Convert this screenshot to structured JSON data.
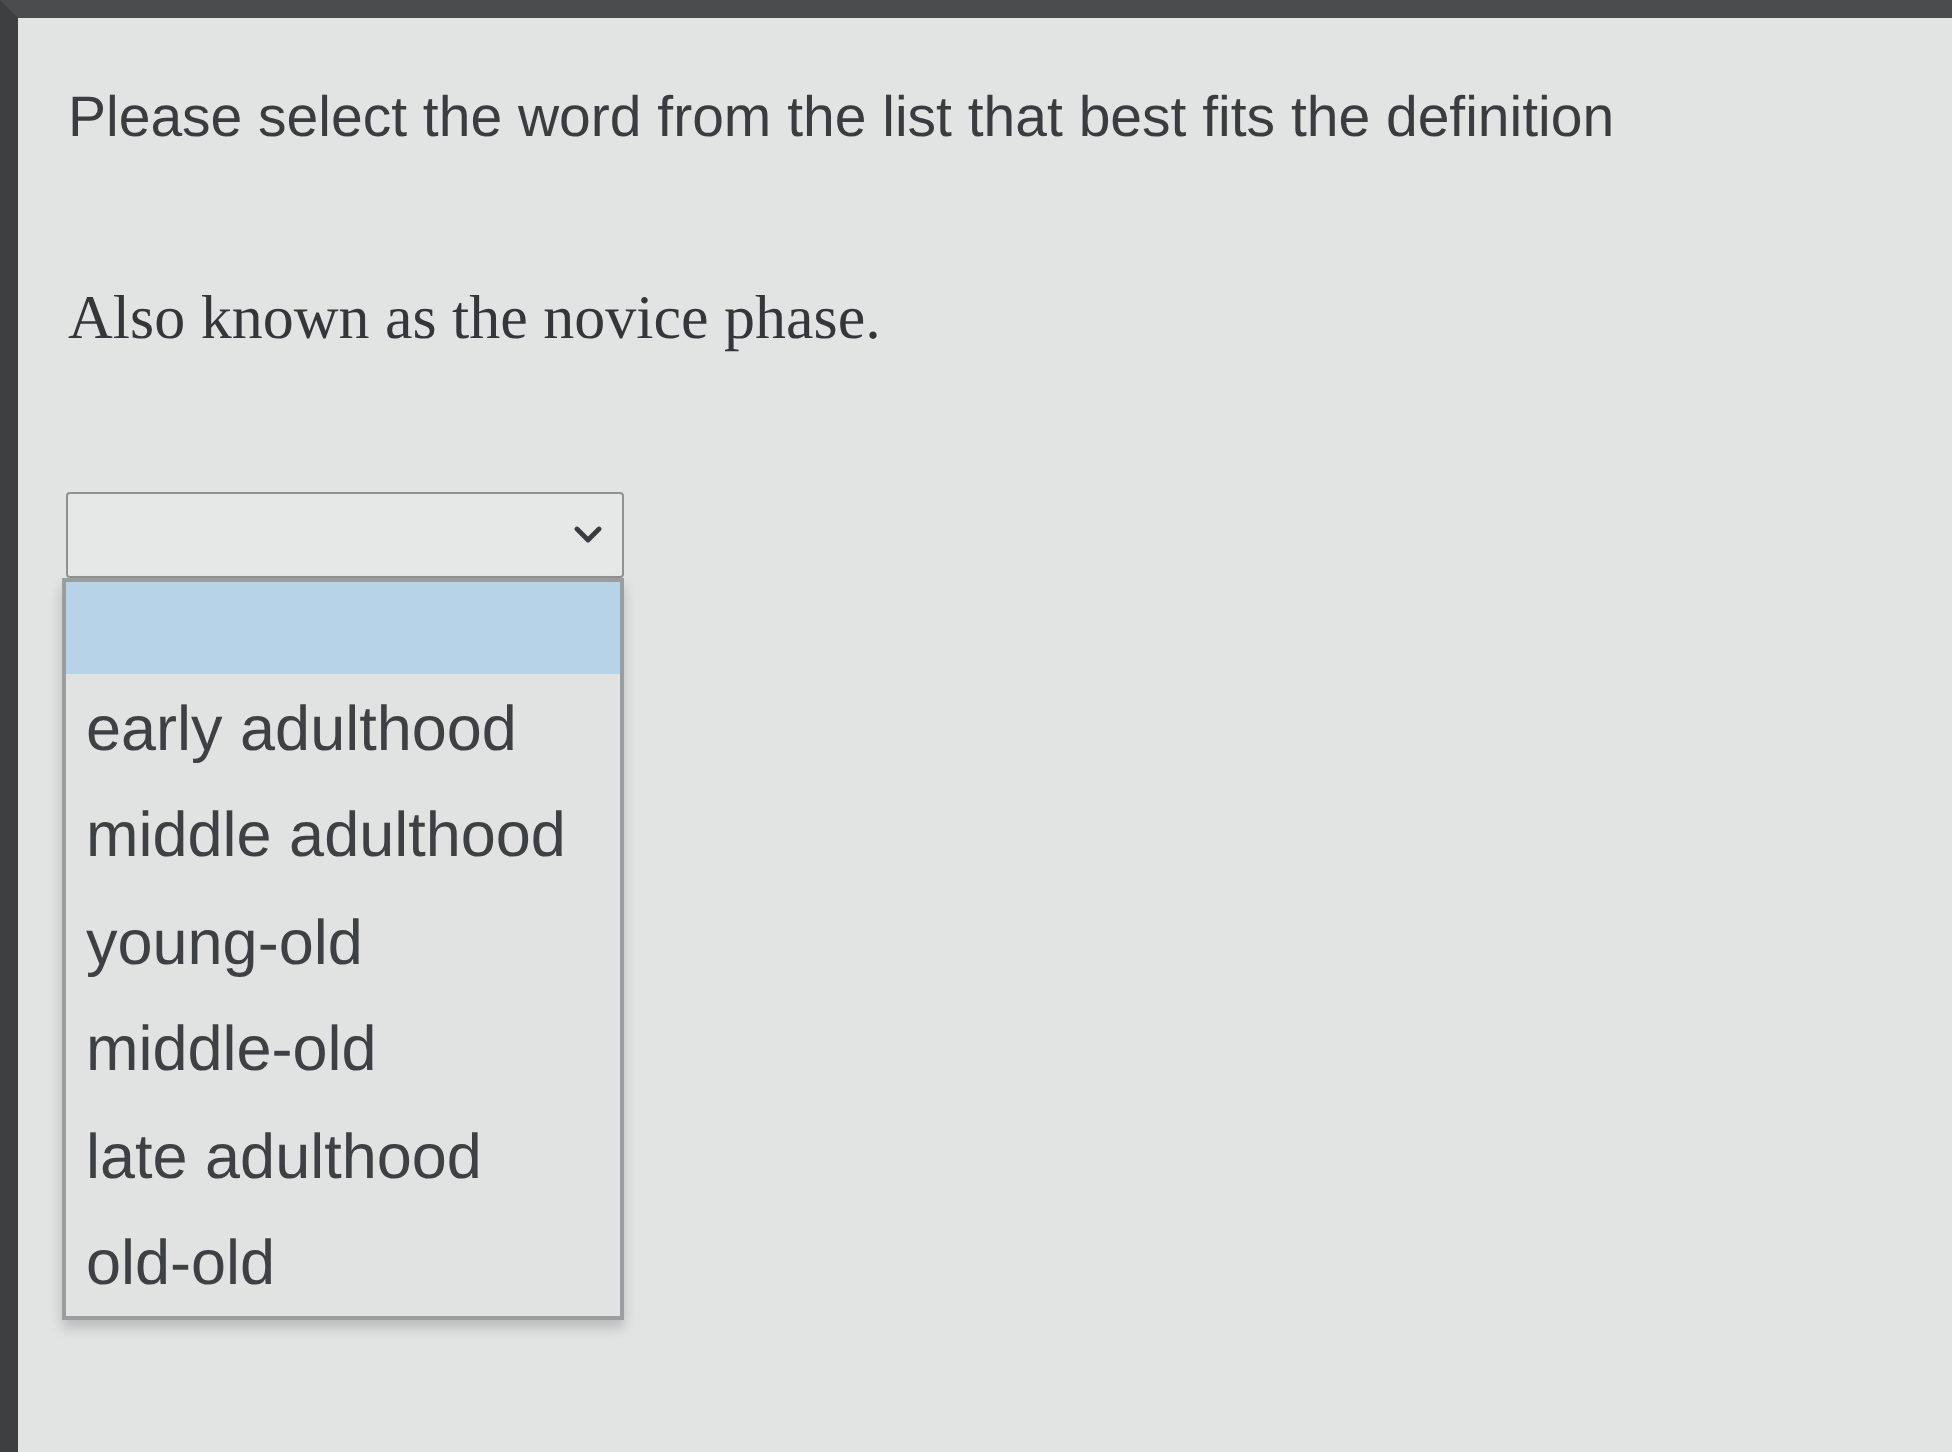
{
  "instruction": "Please select the word from the list that best fits the definition",
  "definition": "Also known as the novice phase.",
  "dropdown": {
    "expanded": true,
    "options": [
      {
        "selected": true
      },
      {
        "label": "early adulthood",
        "selected": false
      },
      {
        "label": "middle adulthood",
        "selected": false
      },
      {
        "label": "young-old",
        "selected": false
      },
      {
        "label": "middle-old",
        "selected": false
      },
      {
        "label": "late adulthood",
        "selected": false
      },
      {
        "label": "old-old",
        "selected": false
      }
    ]
  }
}
